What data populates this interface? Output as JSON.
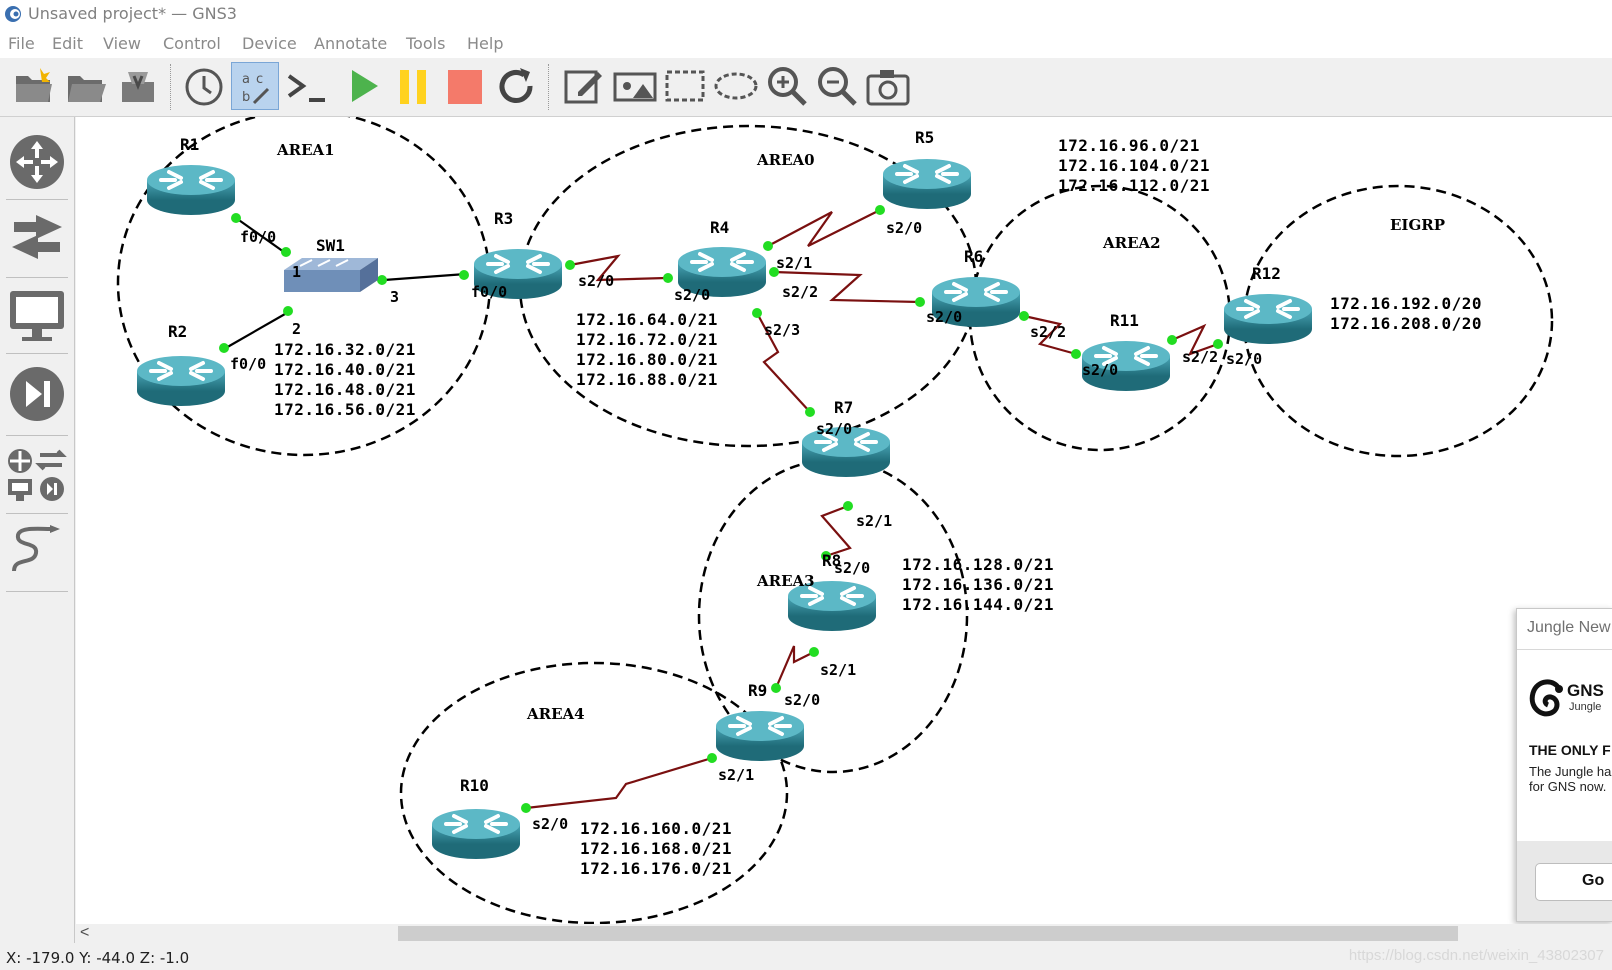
{
  "window": {
    "title": "Unsaved project* — GNS3"
  },
  "menu": [
    "File",
    "Edit",
    "View",
    "Control",
    "Device",
    "Annotate",
    "Tools",
    "Help"
  ],
  "toolbar": {
    "buttons": [
      "new-project",
      "open-project",
      "save-project",
      "snapshot",
      "show-interface-labels",
      "console-all",
      "start-all",
      "suspend-all",
      "stop-all",
      "reload-all",
      "add-note",
      "insert-picture",
      "draw-rectangle",
      "draw-ellipse",
      "zoom-in",
      "zoom-out",
      "screenshot"
    ]
  },
  "dock": {
    "buttons": [
      "browse-routers",
      "browse-switches",
      "browse-end-devices",
      "browse-security-devices",
      "browse-all-devices",
      "add-link"
    ]
  },
  "topology": {
    "areas": [
      "AREA1",
      "AREA0",
      "AREA2",
      "EIGRP",
      "AREA3",
      "AREA4"
    ],
    "devices": [
      "R1",
      "R2",
      "SW1",
      "R3",
      "R4",
      "R5",
      "R6",
      "R11",
      "R12",
      "R7",
      "R8",
      "R9",
      "R10"
    ],
    "ports": {
      "r1_f00": "f0/0",
      "sw1_p1": "1",
      "sw1_p2": "2",
      "sw1_p3": "3",
      "r2_f00": "f0/0",
      "r3_f00": "f0/0",
      "r3_s20": "s2/0",
      "r4_s20": "s2/0",
      "r4_s21": "s2/1",
      "r4_s22": "s2/2",
      "r4_s23": "s2/3",
      "r5_s20": "s2/0",
      "r6_s20": "s2/0",
      "r6_s22": "s2/2",
      "r11_s20": "s2/0",
      "r11_s22": "s2/2",
      "r12_s20": "s2/0",
      "r7_s20": "s2/0",
      "r7_s21": "s2/1",
      "r8_s20": "s2/0",
      "r8_s21": "s2/1",
      "r9_s20": "s2/0",
      "r9_s21": "s2/1",
      "r10_s20": "s2/0"
    },
    "networks": {
      "area1": [
        "172.16.32.0/21",
        "172.16.40.0/21",
        "172.16.48.0/21",
        "172.16.56.0/21"
      ],
      "area0": [
        "172.16.64.0/21",
        "172.16.72.0/21",
        "172.16.80.0/21",
        "172.16.88.0/21"
      ],
      "area2": [
        "172.16.96.0/21",
        "172.16.104.0/21",
        "172.16.112.0/21"
      ],
      "eigrp": [
        "172.16.192.0/20",
        "172.16.208.0/20"
      ],
      "area3": [
        "172.16.128.0/21",
        "172.16.136.0/21",
        "172.16.144.0/21"
      ],
      "area4": [
        "172.16.160.0/21",
        "172.16.168.0/21",
        "172.16.176.0/21"
      ]
    }
  },
  "news": {
    "header": "Jungle New",
    "brand": "GNS",
    "brand_sub": "Jungle",
    "headline": "THE ONLY F",
    "body": "The Jungle ha need for GNS now.",
    "go_label": "Go"
  },
  "status": {
    "coords": "X: -179.0 Y: -44.0 Z: -1.0",
    "watermark": "https://blog.csdn.net/weixin_43802307"
  },
  "colors": {
    "link": "#7a1010",
    "port_dot": "#22dd22",
    "router": "#2e8a9a"
  }
}
